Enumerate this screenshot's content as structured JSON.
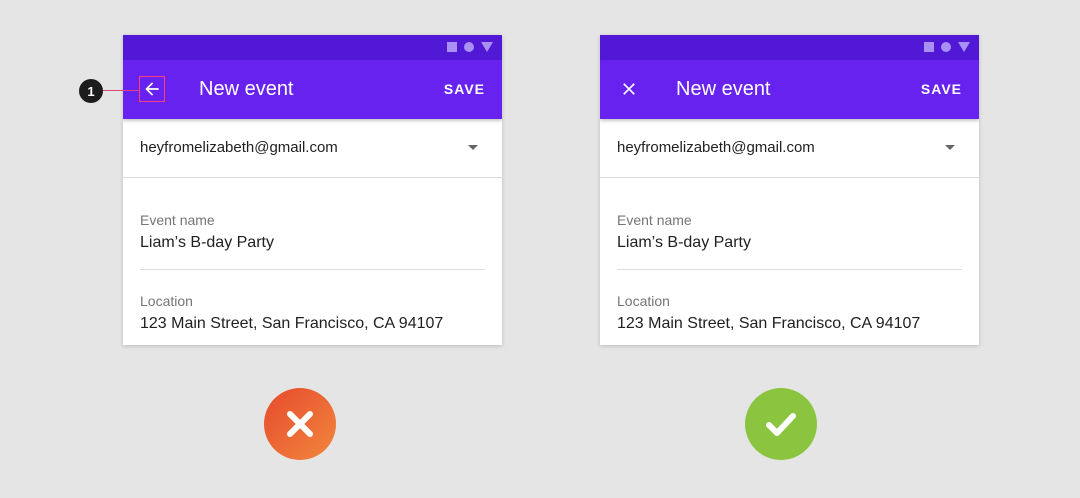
{
  "callout": {
    "number": "1"
  },
  "left_phone": {
    "app_bar": {
      "title": "New event",
      "save_label": "SAVE",
      "nav_icon": "arrow-back-icon"
    },
    "account": {
      "email": "heyfromelizabeth@gmail.com"
    },
    "event_name": {
      "label": "Event name",
      "value": "Liam’s B-day Party"
    },
    "location": {
      "label": "Location",
      "value": "123 Main Street, San Francisco, CA 94107"
    }
  },
  "right_phone": {
    "app_bar": {
      "title": "New event",
      "save_label": "SAVE",
      "nav_icon": "close-icon"
    },
    "account": {
      "email": "heyfromelizabeth@gmail.com"
    },
    "event_name": {
      "label": "Event name",
      "value": "Liam’s B-day Party"
    },
    "location": {
      "label": "Location",
      "value": "123 Main Street, San Francisco, CA 94107"
    }
  },
  "verdicts": {
    "left": "incorrect",
    "right": "correct"
  },
  "colors": {
    "status_bar": "#5119d6",
    "app_bar": "#6822ef",
    "callout_line": "#e0457a",
    "bad": "#ee6a34",
    "good": "#8bc53f"
  }
}
